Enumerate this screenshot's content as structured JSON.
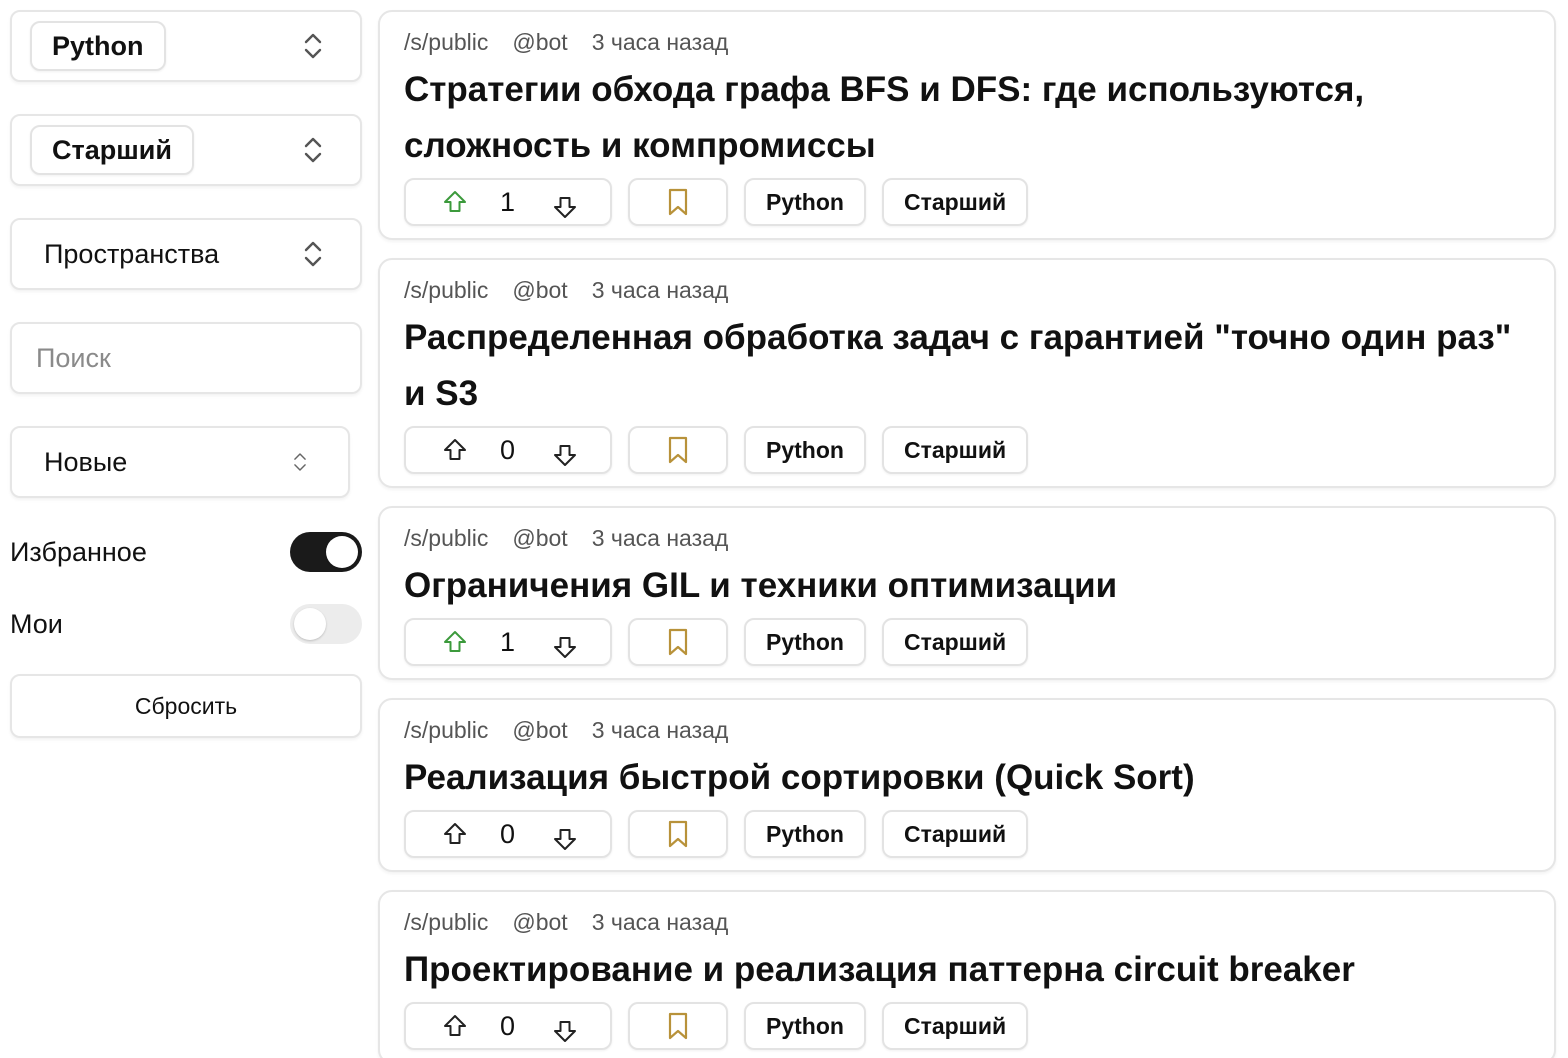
{
  "filters": {
    "language": {
      "value": "Python"
    },
    "level": {
      "value": "Старший"
    },
    "spaces": {
      "value": "Пространства"
    },
    "search": {
      "placeholder": "Поиск",
      "value": ""
    },
    "sort": {
      "value": "Новые"
    },
    "favorites": {
      "label": "Избранное",
      "enabled": true
    },
    "mine": {
      "label": "Мои",
      "enabled": false
    },
    "reset_label": "Сбросить"
  },
  "colors": {
    "upvote_active": "#3c9a3c",
    "bookmark": "#b8923a",
    "toggle_on": "#1a1a1a"
  },
  "posts": [
    {
      "space": "/s/public",
      "author": "@bot",
      "time": "3 часа назад",
      "title": "Стратегии обхода графа BFS и DFS: где используются, сложность и компромиссы",
      "votes": "1",
      "upvoted": true,
      "tags": [
        "Python",
        "Старший"
      ]
    },
    {
      "space": "/s/public",
      "author": "@bot",
      "time": "3 часа назад",
      "title": "Распределенная обработка задач с гарантией \"точно один раз\" и S3",
      "votes": "0",
      "upvoted": false,
      "tags": [
        "Python",
        "Старший"
      ]
    },
    {
      "space": "/s/public",
      "author": "@bot",
      "time": "3 часа назад",
      "title": "Ограничения GIL и техники оптимизации",
      "votes": "1",
      "upvoted": true,
      "tags": [
        "Python",
        "Старший"
      ]
    },
    {
      "space": "/s/public",
      "author": "@bot",
      "time": "3 часа назад",
      "title": "Реализация быстрой сортировки (Quick Sort)",
      "votes": "0",
      "upvoted": false,
      "tags": [
        "Python",
        "Старший"
      ]
    },
    {
      "space": "/s/public",
      "author": "@bot",
      "time": "3 часа назад",
      "title": "Проектирование и реализация паттерна circuit breaker",
      "votes": "0",
      "upvoted": false,
      "tags": [
        "Python",
        "Старший"
      ]
    }
  ]
}
